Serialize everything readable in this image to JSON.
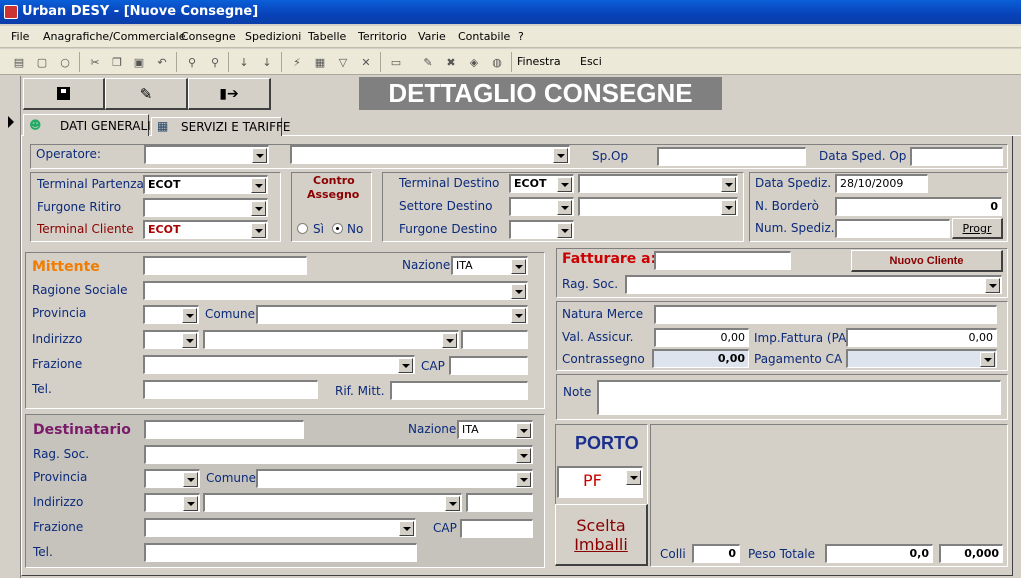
{
  "window": {
    "title": "Urban DESY - [Nuove Consegne]"
  },
  "menu": [
    "File",
    "Anagrafiche/Commerciale",
    "Consegne",
    "Spedizioni",
    "Tabelle",
    "Territorio",
    "Varie",
    "Contabile",
    "?"
  ],
  "toolbar": {
    "finestra": "Finestra",
    "esci": "Esci"
  },
  "header": {
    "title": "DETTAGLIO CONSEGNE"
  },
  "tabs": [
    "DATI GENERALI",
    "SERVIZI E TARIFFE"
  ],
  "operatore": {
    "label": "Operatore:",
    "spop_label": "Sp.Op",
    "data_sped_op_label": "Data Sped. Op"
  },
  "terminal": {
    "partenza_label": "Terminal Partenza",
    "partenza_value": "ECOT",
    "furgone_ritiro_label": "Furgone Ritiro",
    "cliente_label": "Terminal Cliente",
    "cliente_value": "ECOT"
  },
  "contrassegno": {
    "title_line1": "Contro",
    "title_line2": "Assegno",
    "si": "Sì",
    "no": "No"
  },
  "destino": {
    "terminal_label": "Terminal Destino",
    "terminal_value": "ECOT",
    "settore_label": "Settore Destino",
    "furgone_label": "Furgone Destino"
  },
  "spedizione": {
    "data_label": "Data Spediz.",
    "data_value": "28/10/2009",
    "bordero_label": "N. Borderò",
    "bordero_value": "0",
    "num_label": "Num. Spediz.",
    "progr_button": "Progr"
  },
  "mittente": {
    "title": "Mittente",
    "nazione_label": "Nazione",
    "nazione_value": "ITA",
    "ragione_label": "Ragione Sociale",
    "provincia_label": "Provincia",
    "comune_label": "Comune",
    "indirizzo_label": "Indirizzo",
    "frazione_label": "Frazione",
    "cap_label": "CAP",
    "tel_label": "Tel.",
    "rif_label": "Rif. Mitt."
  },
  "destinatario": {
    "title": "Destinatario",
    "nazione_label": "Nazione",
    "nazione_value": "ITA",
    "ragsoc_label": "Rag. Soc.",
    "provincia_label": "Provincia",
    "comune_label": "Comune",
    "indirizzo_label": "Indirizzo",
    "frazione_label": "Frazione",
    "cap_label": "CAP",
    "tel_label": "Tel."
  },
  "fatturare": {
    "label": "Fatturare a:",
    "nuovo_cliente": "Nuovo Cliente",
    "ragsoc_label": "Rag. Soc."
  },
  "merce": {
    "natura_label": "Natura Merce",
    "assicur_label": "Val. Assicur.",
    "assicur_value": "0,00",
    "impfatt_label": "Imp.Fattura (PA)",
    "impfatt_value": "0,00",
    "contrassegno_label": "Contrassegno",
    "contrassegno_value": "0,00",
    "pagamento_label": "Pagamento CA"
  },
  "note": {
    "label": "Note"
  },
  "porto": {
    "title": "PORTO",
    "value": "PF"
  },
  "imballi": {
    "line1": "Scelta",
    "line2": "Imballi"
  },
  "totali": {
    "colli_label": "Colli",
    "colli_value": "0",
    "peso_label": "Peso Totale",
    "peso_value": "0,0",
    "volume_value": "0,000"
  }
}
